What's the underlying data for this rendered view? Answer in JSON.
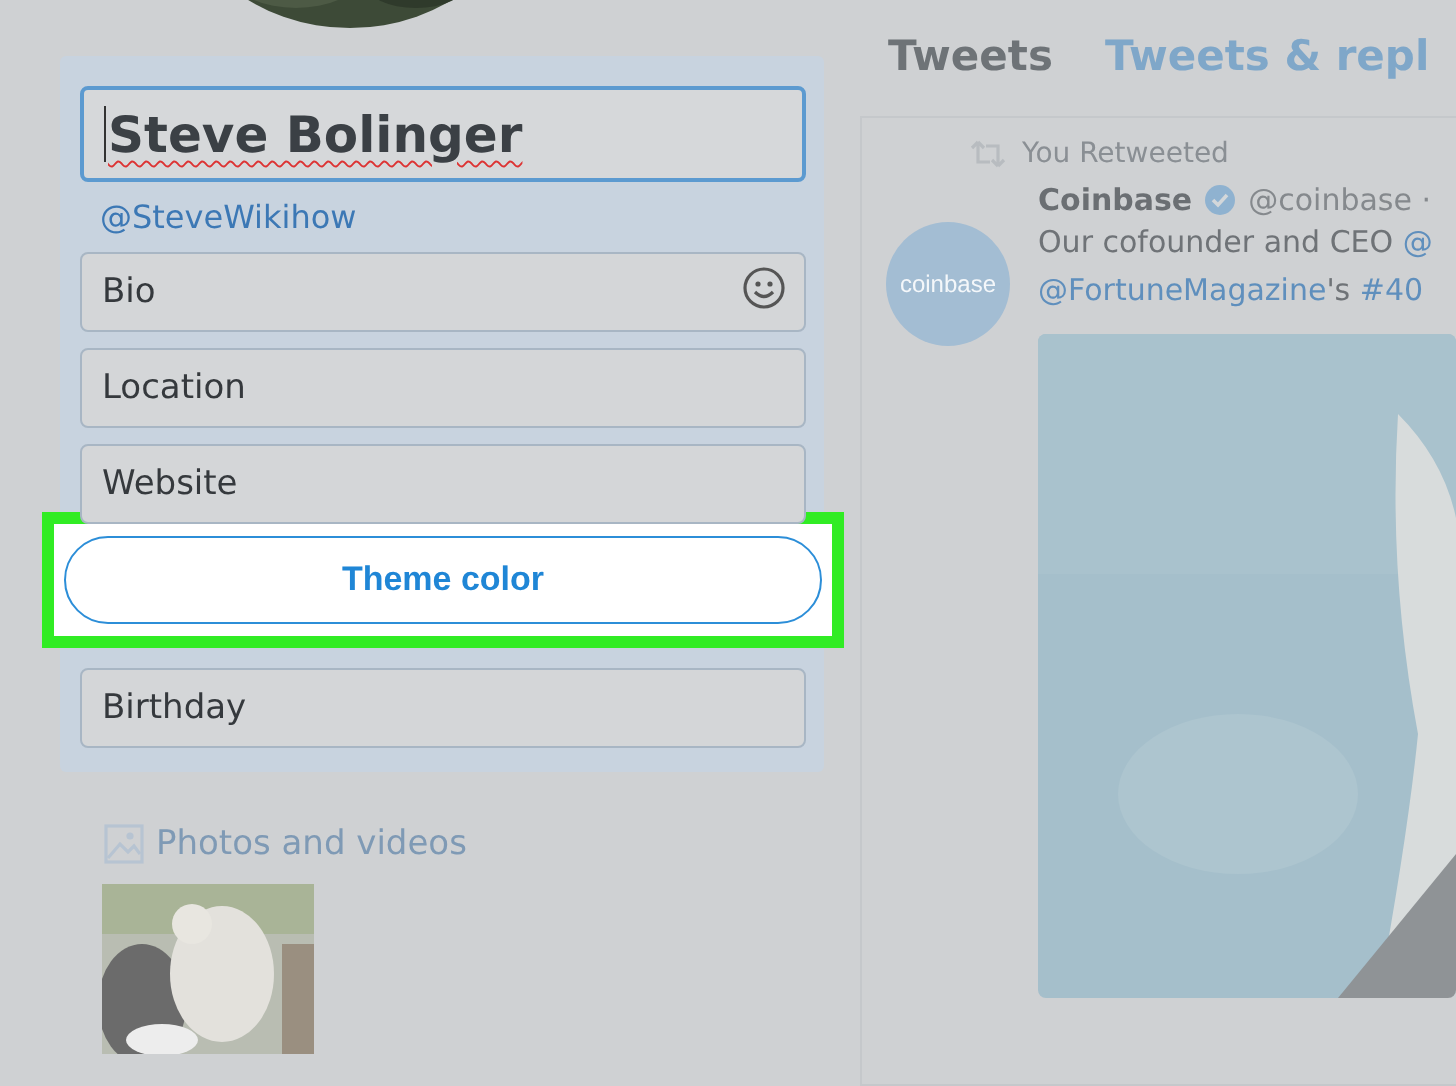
{
  "profile_form": {
    "name_field": {
      "value": "Steve Bolinger",
      "focused": true,
      "misspelled": true
    },
    "handle": "@SteveWikihow",
    "fields": [
      {
        "placeholder": "Bio",
        "emoji": true
      },
      {
        "placeholder": "Location",
        "emoji": false
      },
      {
        "placeholder": "Website",
        "emoji": false
      }
    ],
    "theme_button": {
      "label": "Theme color",
      "highlighted": true
    },
    "birthday_field": {
      "placeholder": "Birthday"
    }
  },
  "media": {
    "label": "Photos and videos"
  },
  "tabs": [
    {
      "label": "Tweets",
      "selected": true
    },
    {
      "label": "Tweets & repl",
      "selected": false
    }
  ],
  "tweet": {
    "retweet_label": "You Retweeted",
    "avatar_text": "coinbase",
    "author": "Coinbase",
    "verified": true,
    "handle": "@coinbase ·",
    "lines": [
      [
        {
          "text": "Our cofounder and CEO ",
          "link": false
        },
        {
          "text": "@",
          "link": true
        }
      ],
      [
        {
          "text": "@FortuneMagazine",
          "link": true
        },
        {
          "text": "'s ",
          "link": false
        },
        {
          "text": "#40",
          "link": true
        }
      ]
    ]
  }
}
